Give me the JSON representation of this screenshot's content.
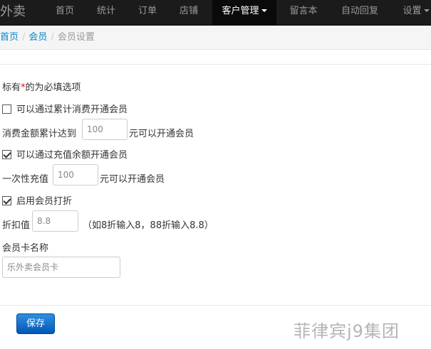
{
  "navbar": {
    "brand": "乐外卖",
    "items": [
      {
        "label": "首页"
      },
      {
        "label": "统计"
      },
      {
        "label": "订单"
      },
      {
        "label": "店铺"
      },
      {
        "label": "客户管理"
      },
      {
        "label": "留言本"
      },
      {
        "label": "自动回复"
      },
      {
        "label": "设置"
      }
    ]
  },
  "breadcrumb": {
    "home": "首页",
    "members": "会员",
    "current": "会员设置",
    "separator": "/"
  },
  "form": {
    "required_note_prefix": "标有",
    "required_mark": "*",
    "required_note_suffix": "的为必填选项",
    "cumulative_option": {
      "label": "可以通过累计消费开通会员",
      "checked": false
    },
    "cumulative_amount": {
      "prefix": "消费金额累计达到",
      "placeholder": "100",
      "suffix": "元可以开通会员"
    },
    "recharge_option": {
      "label": "可以通过充值余额开通会员",
      "checked": true
    },
    "recharge_amount": {
      "prefix": "一次性充值",
      "placeholder": "100",
      "suffix": "元可以开通会员"
    },
    "discount_option": {
      "label": "启用会员打折",
      "checked": true
    },
    "discount_value": {
      "prefix": "折扣值",
      "placeholder": "8.8",
      "hint": "（如8折输入8，88折输入8.8）"
    },
    "card_name": {
      "label": "会员卡名称",
      "placeholder": "乐外卖会员卡"
    }
  },
  "actions": {
    "save_label": "保存"
  },
  "watermark": "菲律宾j9集团"
}
